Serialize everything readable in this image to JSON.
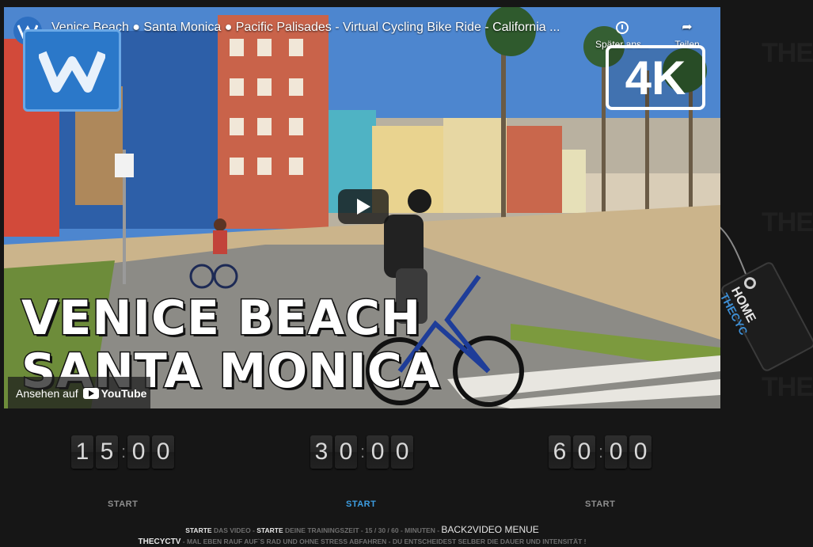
{
  "video": {
    "title": "Venice Beach ● Santa Monica ● Pacific Palisades - Virtual Cycling Bike Ride - California ...",
    "watch_later_label": "Später ans...",
    "share_label": "Teilen",
    "badge_4k": "4K",
    "overlay_line1": "VENICE BEACH",
    "overlay_line2": "SANTA MONICA",
    "watch_on_label": "Ansehen auf",
    "youtube_label": "YouTube"
  },
  "home_tag": {
    "line1": "HOME",
    "line2": "THECYC"
  },
  "background_brand": "THECYC",
  "timers": [
    {
      "d1": "1",
      "d2": "5",
      "d3": "0",
      "d4": "0",
      "start_label": "START",
      "active": false
    },
    {
      "d1": "3",
      "d2": "0",
      "d3": "0",
      "d4": "0",
      "start_label": "START",
      "active": true
    },
    {
      "d1": "6",
      "d2": "0",
      "d3": "0",
      "d4": "0",
      "start_label": "START",
      "active": false
    }
  ],
  "footer": {
    "l1_a": "STARTE",
    "l1_b": " DAS VIDEO - ",
    "l1_c": "STARTE",
    "l1_d": " DEINE TRAININGSZEIT - 15 / 30 / 60 - MINUTEN - ",
    "l1_e": "BACK2VIDEO MENUE",
    "l2_a": "THECYCTV",
    "l2_b": " - MAL EBEN RAUF AUF`S RAD UND OHNE STRESS ABFAHREN - DU ENTSCHEIDEST SELBER DIE DAUER UND INTENSITÄT !"
  },
  "colors": {
    "accent": "#3d9de0",
    "youtube_blue": "#2d6fc1",
    "background": "#161616"
  }
}
